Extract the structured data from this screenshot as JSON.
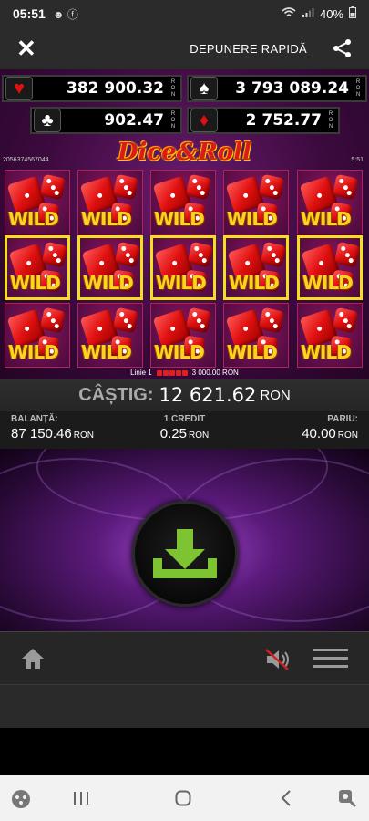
{
  "status": {
    "time": "05:51",
    "battery": "40%"
  },
  "topbar": {
    "title": "DEPUNERE RAPIDĂ"
  },
  "jackpots": [
    {
      "suit": "heart",
      "glyph": "♥",
      "value": "382 900.32",
      "currency": "RON",
      "color": "#e01010"
    },
    {
      "suit": "spade",
      "glyph": "♠",
      "value": "3 793 089.24",
      "currency": "RON",
      "color": "#ffffff"
    },
    {
      "suit": "club",
      "glyph": "♣",
      "value": "902.47",
      "currency": "RON",
      "color": "#ffffff"
    },
    {
      "suit": "diamond",
      "glyph": "♦",
      "value": "2 752.77",
      "currency": "RON",
      "color": "#e01010"
    }
  ],
  "game": {
    "logo": "Dice&Roll",
    "id": "2056374567044",
    "time": "5:51",
    "wild_label": "WILD",
    "win_line": {
      "label": "Linie 1",
      "amount": "3 000.00",
      "currency": "RON"
    }
  },
  "win": {
    "label": "CÂȘTIG:",
    "amount": "12 621.62",
    "currency": "RON"
  },
  "info": {
    "balance": {
      "label": "BALANȚĂ:",
      "value": "87 150.46",
      "currency": "RON"
    },
    "credit": {
      "label": "1 CREDIT",
      "value": "0.25",
      "currency": "RON"
    },
    "bet": {
      "label": "PARIU:",
      "value": "40.00",
      "currency": "RON"
    }
  },
  "colors": {
    "accent_green": "#7ec432",
    "win_border": "#f3df22"
  }
}
